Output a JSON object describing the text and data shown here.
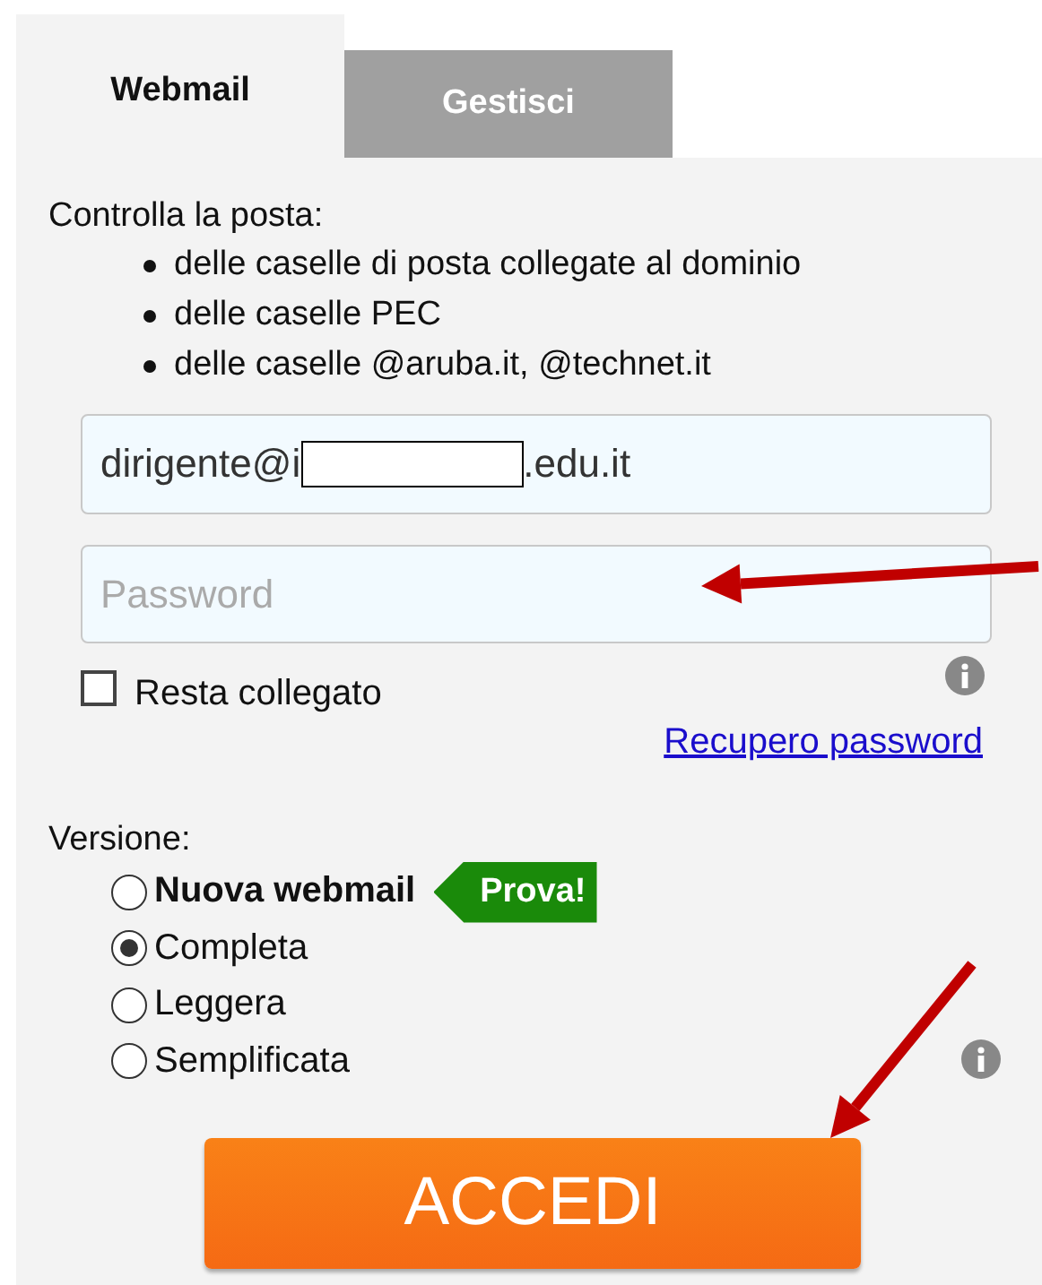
{
  "tabs": [
    {
      "label": "Webmail",
      "selected": true
    },
    {
      "label": "Gestisci",
      "selected": false
    }
  ],
  "intro": {
    "heading": "Controlla la posta:",
    "items": [
      "delle caselle di posta collegate al dominio",
      "delle caselle PEC",
      "delle caselle @aruba.it, @technet.it"
    ]
  },
  "email": {
    "value_start": "dirigente@i",
    "redacted": true,
    "value_end": ".edu.it"
  },
  "password": {
    "placeholder": "Password"
  },
  "remember": {
    "label": "Resta collegato",
    "checked": false
  },
  "recover_link": "Recupero password",
  "version": {
    "heading": "Versione:",
    "options": [
      {
        "label": "Nuova webmail",
        "selected": false,
        "tag": "Prova!"
      },
      {
        "label": "Completa",
        "selected": true
      },
      {
        "label": "Leggera",
        "selected": false
      },
      {
        "label": "Semplificata",
        "selected": false
      }
    ]
  },
  "submit": "ACCEDI"
}
